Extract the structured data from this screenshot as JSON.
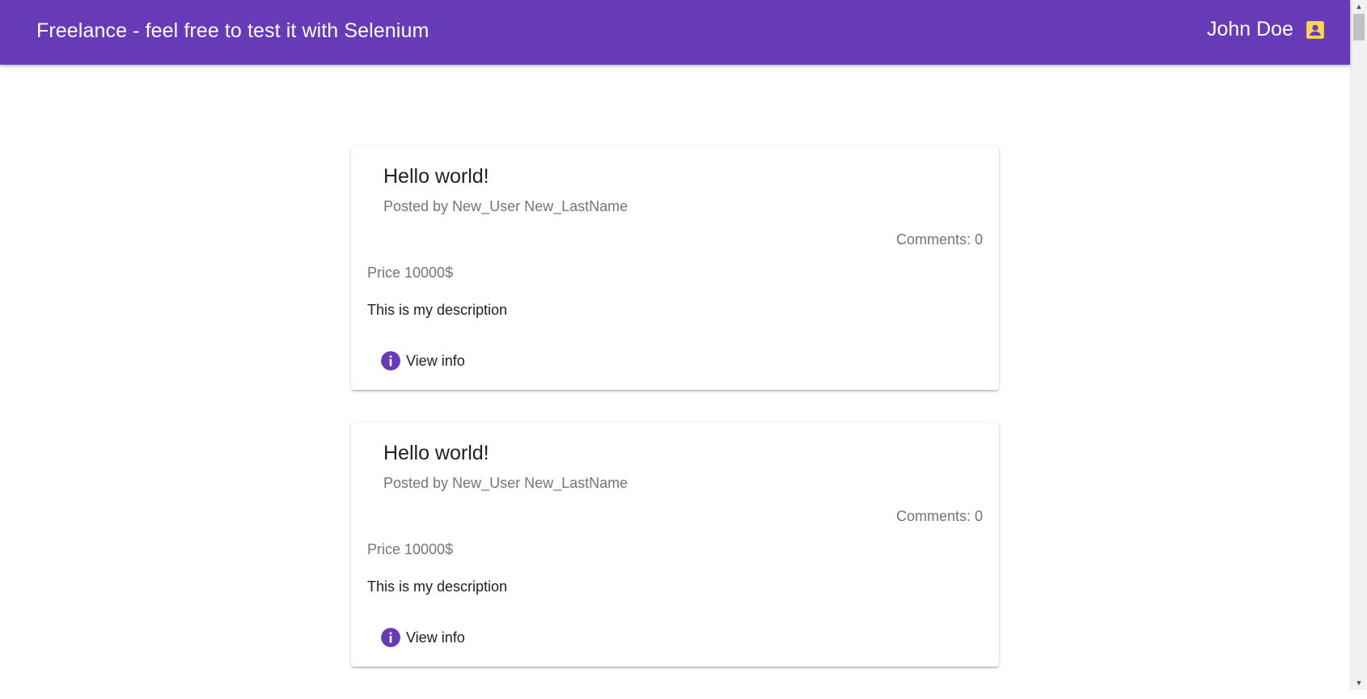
{
  "header": {
    "title": "Freelance - feel free to test it with Selenium",
    "user_name": "John Doe",
    "user_icon": "account-box-icon",
    "bar_color": "#673ab7",
    "icon_color": "#ffd54f"
  },
  "posts": [
    {
      "title": "Hello world!",
      "posted_by": "Posted by New_User New_LastName",
      "comments": "Comments: 0",
      "price": "Price 10000$",
      "description": "This is my description",
      "view_label": "View info",
      "view_icon": "info-icon"
    },
    {
      "title": "Hello world!",
      "posted_by": "Posted by New_User New_LastName",
      "comments": "Comments: 0",
      "price": "Price 10000$",
      "description": "This is my description",
      "view_label": "View info",
      "view_icon": "info-icon"
    }
  ]
}
